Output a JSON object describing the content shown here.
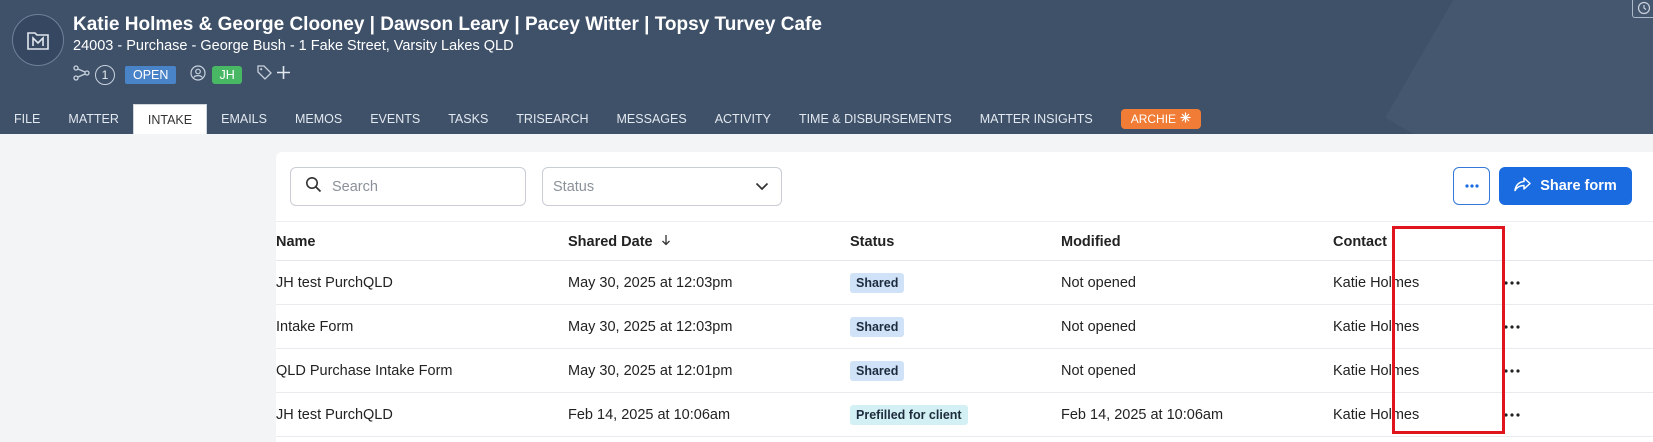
{
  "header": {
    "title": "Katie Holmes & George Clooney | Dawson Leary | Pacey Witter | Topsy Turvey Cafe",
    "subtitle": "24003 - Purchase - George Bush - 1 Fake Street, Varsity Lakes QLD",
    "related_count": "1",
    "status_badge": "OPEN",
    "assignee_initials": "JH"
  },
  "tabs": [
    {
      "label": "FILE"
    },
    {
      "label": "MATTER"
    },
    {
      "label": "INTAKE",
      "active": true
    },
    {
      "label": "EMAILS"
    },
    {
      "label": "MEMOS"
    },
    {
      "label": "EVENTS"
    },
    {
      "label": "TASKS"
    },
    {
      "label": "TRISEARCH"
    },
    {
      "label": "MESSAGES"
    },
    {
      "label": "ACTIVITY"
    },
    {
      "label": "TIME & DISBURSEMENTS"
    },
    {
      "label": "MATTER INSIGHTS"
    },
    {
      "label": "ARCHIE"
    }
  ],
  "toolbar": {
    "search_placeholder": "Search",
    "status_placeholder": "Status",
    "share_label": "Share form"
  },
  "table": {
    "columns": [
      "Name",
      "Shared Date",
      "Status",
      "Modified",
      "Contact"
    ],
    "rows": [
      {
        "name": "JH test PurchQLD",
        "shared_date": "May 30, 2025 at 12:03pm",
        "status": "Shared",
        "modified": "Not opened",
        "contact": "Katie Holmes"
      },
      {
        "name": "Intake Form",
        "shared_date": "May 30, 2025 at 12:03pm",
        "status": "Shared",
        "modified": "Not opened",
        "contact": "Katie Holmes"
      },
      {
        "name": "QLD Purchase Intake Form",
        "shared_date": "May 30, 2025 at 12:01pm",
        "status": "Shared",
        "modified": "Not opened",
        "contact": "Katie Holmes"
      },
      {
        "name": "JH test PurchQLD",
        "shared_date": "Feb 14, 2025 at 10:06am",
        "status": "Prefilled for client",
        "modified": "Feb 14, 2025 at 10:06am",
        "contact": "Katie Holmes"
      }
    ]
  },
  "colors": {
    "header_bg": "#3f5169",
    "primary_button": "#1a6be0",
    "archie_tab": "#f07c35",
    "open_badge": "#4a84c8",
    "assignee_badge": "#48b864",
    "status_shared": "#cfe2f7",
    "status_prefilled": "#d3f1f4",
    "highlight_box": "#e0141d"
  }
}
